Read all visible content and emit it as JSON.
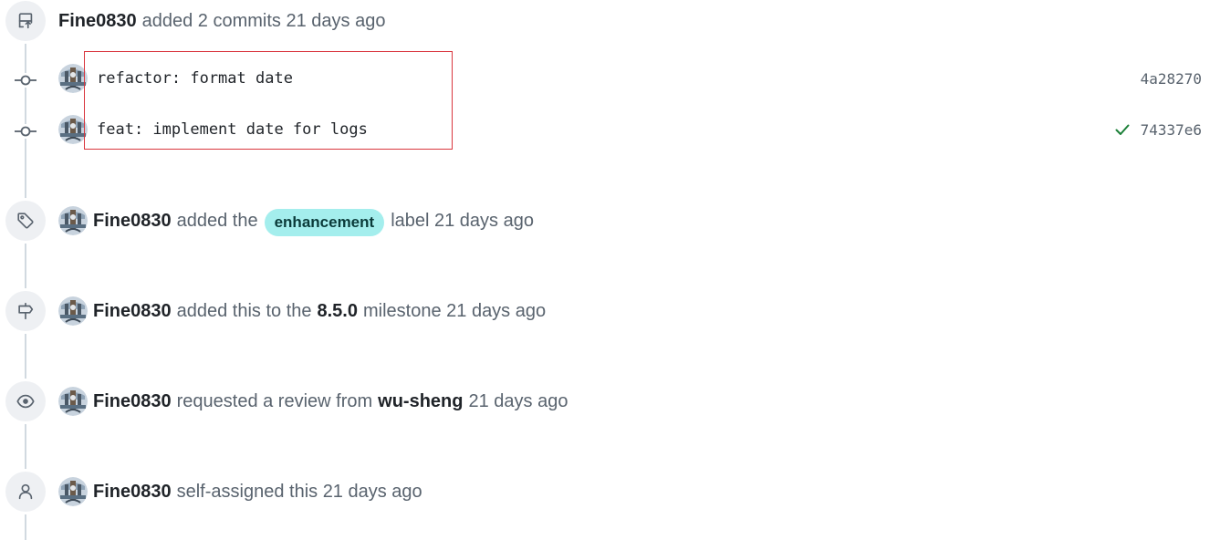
{
  "colors": {
    "label_bg": "#a4eeed",
    "check_green": "#1a7f37",
    "highlight_border": "#d9363e"
  },
  "events": {
    "commits_header": {
      "icon": "repo-push-icon",
      "author": "Fine0830",
      "text": "added 2 commits 21 days ago"
    },
    "commits": [
      {
        "message": "refactor: format date",
        "sha": "4a28270",
        "status": null
      },
      {
        "message": "feat: implement date for logs",
        "sha": "74337e6",
        "status": "check-icon"
      }
    ],
    "label_event": {
      "icon": "tag-icon",
      "author": "Fine0830",
      "before": "added the",
      "label": "enhancement",
      "after": "label 21 days ago"
    },
    "milestone_event": {
      "icon": "milestone-icon",
      "author": "Fine0830",
      "before": "added this to the",
      "milestone": "8.5.0",
      "after": "milestone 21 days ago"
    },
    "review_event": {
      "icon": "eye-icon",
      "author": "Fine0830",
      "before": "requested a review from",
      "reviewer": "wu-sheng",
      "after": "21 days ago"
    },
    "assign_event": {
      "icon": "person-icon",
      "author": "Fine0830",
      "text": "self-assigned this 21 days ago"
    }
  }
}
